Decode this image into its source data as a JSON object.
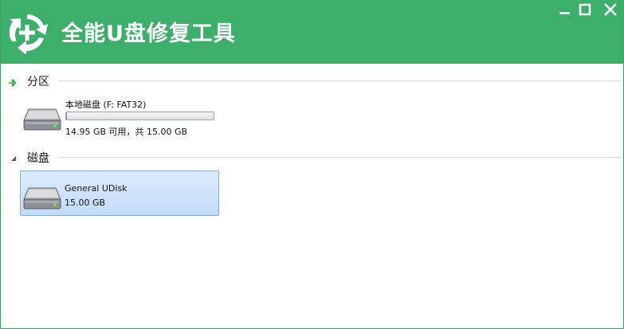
{
  "window": {
    "title": "全能U盘修复工具",
    "accent_color": "#3cb06a",
    "controls": {
      "minimize_icon": "minimize-icon",
      "maximize_icon": "maximize-icon",
      "close_icon": "close-icon"
    }
  },
  "sections": {
    "partitions": {
      "label": "分区",
      "items": [
        {
          "name": "本地磁盘 (F: FAT32)",
          "free_text": "14.95 GB 可用，共 15.00 GB",
          "used_fraction": 0.0033,
          "icon": "drive-icon"
        }
      ]
    },
    "disks": {
      "label": "磁盘",
      "items": [
        {
          "name": "General UDisk",
          "size": "15.00 GB",
          "selected": true,
          "icon": "drive-icon"
        }
      ]
    }
  }
}
